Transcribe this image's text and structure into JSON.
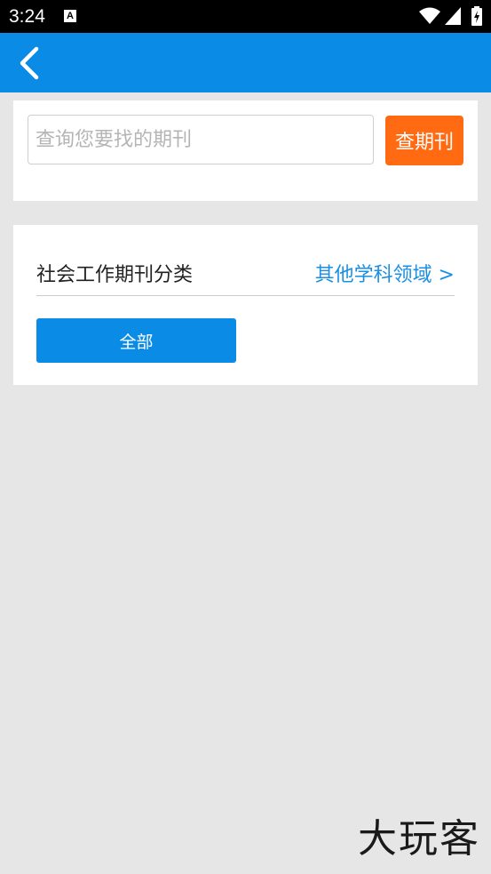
{
  "status_bar": {
    "time": "3:24",
    "notification_icon_letter": "A",
    "icons": [
      "a-notification-icon",
      "wifi-icon",
      "signal-icon",
      "battery-icon"
    ]
  },
  "app_bar": {
    "color": "#0a8be6",
    "back_icon": "chevron-left-icon"
  },
  "search": {
    "placeholder": "查询您要找的期刊",
    "value": "",
    "button_label": "查期刊",
    "button_color": "#ff6a12"
  },
  "category": {
    "title": "社会工作期刊分类",
    "other_link": "其他学科领域 >",
    "link_color": "#1a8fe3",
    "all_button_label": "全部"
  },
  "watermark": {
    "text": "大玩客"
  }
}
